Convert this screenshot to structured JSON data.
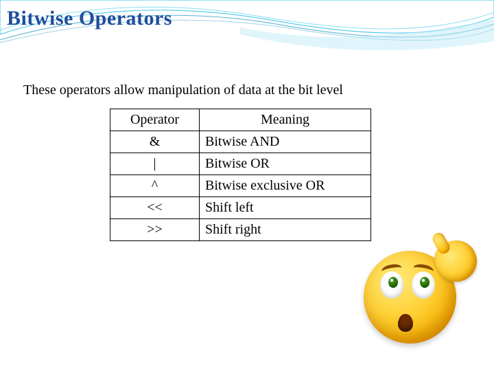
{
  "title": "Bitwise Operators",
  "subtitle": "These operators allow manipulation of data at the bit level",
  "table": {
    "header": {
      "operator": "Operator",
      "meaning": "Meaning"
    },
    "rows": [
      {
        "operator": "&",
        "meaning": "Bitwise AND"
      },
      {
        "operator": "|",
        "meaning": "Bitwise OR"
      },
      {
        "operator": "^",
        "meaning": "Bitwise exclusive OR"
      },
      {
        "operator": "<<",
        "meaning": "Shift left"
      },
      {
        "operator": ">>",
        "meaning": "Shift right"
      }
    ]
  }
}
